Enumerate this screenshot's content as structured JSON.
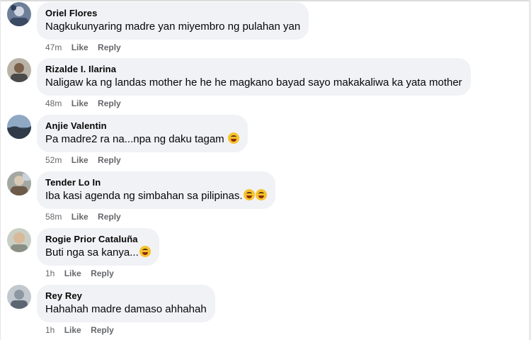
{
  "comments": [
    {
      "author": "Oriel Flores",
      "text": "Nagkukunyaring madre yan miyembro ng pulahan yan",
      "emojis": [],
      "time": "47m",
      "like_label": "Like",
      "reply_label": "Reply"
    },
    {
      "author": "Rizalde I. Ilarina",
      "text": "Naligaw ka ng landas mother he he he magkano bayad sayo makakaliwa ka yata mother",
      "emojis": [],
      "time": "48m",
      "like_label": "Like",
      "reply_label": "Reply"
    },
    {
      "author": "Anjie Valentin",
      "text": "Pa madre2 ra na...npa ng daku tagam",
      "emojis": [
        "laughing-emoji"
      ],
      "time": "52m",
      "like_label": "Like",
      "reply_label": "Reply"
    },
    {
      "author": "Tender Lo In",
      "text": "Iba kasi agenda ng simbahan sa pilipinas.",
      "emojis": [
        "rofl-emoji",
        "rofl-emoji"
      ],
      "time": "58m",
      "like_label": "Like",
      "reply_label": "Reply"
    },
    {
      "author": "Rogie Prior Cataluña",
      "text": "Buti nga sa kanya...",
      "emojis": [
        "rofl-emoji"
      ],
      "time": "1h",
      "like_label": "Like",
      "reply_label": "Reply"
    },
    {
      "author": "Rey Rey",
      "text": "Hahahah madre damaso ahhahah",
      "emojis": [],
      "time": "1h",
      "like_label": "Like",
      "reply_label": "Reply"
    }
  ]
}
